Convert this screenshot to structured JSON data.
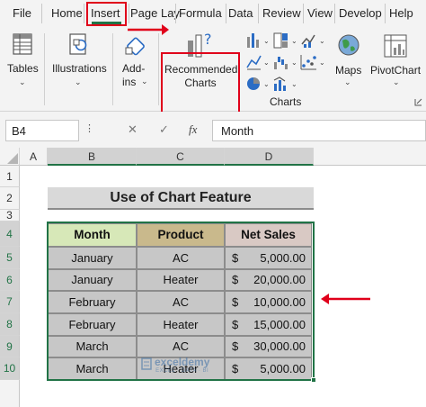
{
  "menu": {
    "tabs": [
      "File",
      "Home",
      "Insert",
      "Page Lay",
      "Formula",
      "Data",
      "Review",
      "View",
      "Develop",
      "Help"
    ]
  },
  "ribbon": {
    "tables": "Tables",
    "illustrations": "Illustrations",
    "addins_line1": "Add-",
    "addins_line2": "ins",
    "recommended_line1": "Recommended",
    "recommended_line2": "Charts",
    "charts_group": "Charts",
    "maps": "Maps",
    "pivotchart": "PivotChart"
  },
  "formula_bar": {
    "name_box": "B4",
    "cancel": "✕",
    "enter": "✓",
    "fx": "fx",
    "value": "Month"
  },
  "grid": {
    "columns": [
      "A",
      "B",
      "C",
      "D"
    ],
    "rows": [
      "1",
      "2",
      "3",
      "4",
      "5",
      "6",
      "7",
      "8",
      "9",
      "10"
    ],
    "title": "Use of Chart Feature",
    "headers": [
      "Month",
      "Product",
      "Net Sales"
    ],
    "currency": "$",
    "data": [
      {
        "month": "January",
        "product": "AC",
        "sales": "5,000.00"
      },
      {
        "month": "January",
        "product": "Heater",
        "sales": "20,000.00"
      },
      {
        "month": "February",
        "product": "AC",
        "sales": "10,000.00"
      },
      {
        "month": "February",
        "product": "Heater",
        "sales": "15,000.00"
      },
      {
        "month": "March",
        "product": "AC",
        "sales": "30,000.00"
      },
      {
        "month": "March",
        "product": "Heater",
        "sales": "5,000.00"
      }
    ]
  },
  "watermark": "exceldemy",
  "watermark_sub": "EXCEL · DATA · BI",
  "colors": {
    "annotation_red": "#e0001a",
    "excel_green": "#217346",
    "header_month": "#d7e8b8",
    "header_product": "#c9b98c",
    "header_sales": "#d9c9c4",
    "table_body": "#c7c7c7"
  }
}
